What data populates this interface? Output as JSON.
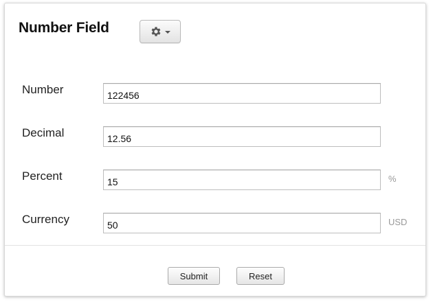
{
  "form": {
    "title": "Number Field",
    "settings_icon": "gear-icon",
    "fields": [
      {
        "label": "Number",
        "value": "122456",
        "suffix": ""
      },
      {
        "label": "Decimal",
        "value": "12.56",
        "suffix": ""
      },
      {
        "label": "Percent",
        "value": "15",
        "suffix": "%"
      },
      {
        "label": "Currency",
        "value": "50",
        "suffix": "USD"
      }
    ],
    "buttons": {
      "submit_label": "Submit",
      "reset_label": "Reset"
    }
  },
  "colors": {
    "suffix_text": "#999999",
    "border": "#bdbdbd"
  }
}
